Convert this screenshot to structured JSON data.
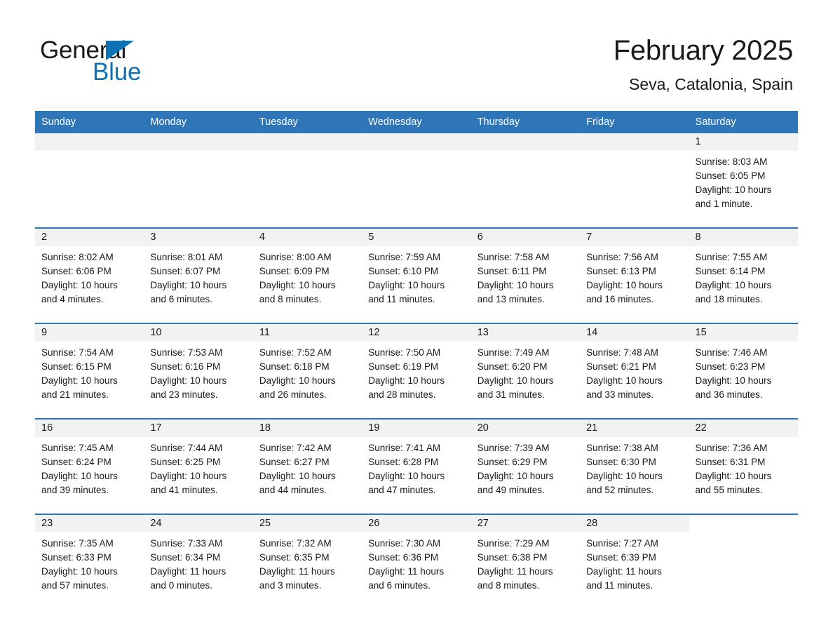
{
  "logo": {
    "word1": "General",
    "word2": "Blue",
    "triangle_color": "#0e72b5"
  },
  "header": {
    "month_title": "February 2025",
    "location": "Seva, Catalonia, Spain",
    "accent_color": "#2f76b8"
  },
  "calendar": {
    "weekday_headers": [
      "Sunday",
      "Monday",
      "Tuesday",
      "Wednesday",
      "Thursday",
      "Friday",
      "Saturday"
    ],
    "weeks": [
      [
        {
          "day": "",
          "blank": true
        },
        {
          "day": "",
          "blank": true
        },
        {
          "day": "",
          "blank": true
        },
        {
          "day": "",
          "blank": true
        },
        {
          "day": "",
          "blank": true
        },
        {
          "day": "",
          "blank": true
        },
        {
          "day": "1",
          "sunrise": "Sunrise: 8:03 AM",
          "sunset": "Sunset: 6:05 PM",
          "daylight1": "Daylight: 10 hours",
          "daylight2": "and 1 minute."
        }
      ],
      [
        {
          "day": "2",
          "sunrise": "Sunrise: 8:02 AM",
          "sunset": "Sunset: 6:06 PM",
          "daylight1": "Daylight: 10 hours",
          "daylight2": "and 4 minutes."
        },
        {
          "day": "3",
          "sunrise": "Sunrise: 8:01 AM",
          "sunset": "Sunset: 6:07 PM",
          "daylight1": "Daylight: 10 hours",
          "daylight2": "and 6 minutes."
        },
        {
          "day": "4",
          "sunrise": "Sunrise: 8:00 AM",
          "sunset": "Sunset: 6:09 PM",
          "daylight1": "Daylight: 10 hours",
          "daylight2": "and 8 minutes."
        },
        {
          "day": "5",
          "sunrise": "Sunrise: 7:59 AM",
          "sunset": "Sunset: 6:10 PM",
          "daylight1": "Daylight: 10 hours",
          "daylight2": "and 11 minutes."
        },
        {
          "day": "6",
          "sunrise": "Sunrise: 7:58 AM",
          "sunset": "Sunset: 6:11 PM",
          "daylight1": "Daylight: 10 hours",
          "daylight2": "and 13 minutes."
        },
        {
          "day": "7",
          "sunrise": "Sunrise: 7:56 AM",
          "sunset": "Sunset: 6:13 PM",
          "daylight1": "Daylight: 10 hours",
          "daylight2": "and 16 minutes."
        },
        {
          "day": "8",
          "sunrise": "Sunrise: 7:55 AM",
          "sunset": "Sunset: 6:14 PM",
          "daylight1": "Daylight: 10 hours",
          "daylight2": "and 18 minutes."
        }
      ],
      [
        {
          "day": "9",
          "sunrise": "Sunrise: 7:54 AM",
          "sunset": "Sunset: 6:15 PM",
          "daylight1": "Daylight: 10 hours",
          "daylight2": "and 21 minutes."
        },
        {
          "day": "10",
          "sunrise": "Sunrise: 7:53 AM",
          "sunset": "Sunset: 6:16 PM",
          "daylight1": "Daylight: 10 hours",
          "daylight2": "and 23 minutes."
        },
        {
          "day": "11",
          "sunrise": "Sunrise: 7:52 AM",
          "sunset": "Sunset: 6:18 PM",
          "daylight1": "Daylight: 10 hours",
          "daylight2": "and 26 minutes."
        },
        {
          "day": "12",
          "sunrise": "Sunrise: 7:50 AM",
          "sunset": "Sunset: 6:19 PM",
          "daylight1": "Daylight: 10 hours",
          "daylight2": "and 28 minutes."
        },
        {
          "day": "13",
          "sunrise": "Sunrise: 7:49 AM",
          "sunset": "Sunset: 6:20 PM",
          "daylight1": "Daylight: 10 hours",
          "daylight2": "and 31 minutes."
        },
        {
          "day": "14",
          "sunrise": "Sunrise: 7:48 AM",
          "sunset": "Sunset: 6:21 PM",
          "daylight1": "Daylight: 10 hours",
          "daylight2": "and 33 minutes."
        },
        {
          "day": "15",
          "sunrise": "Sunrise: 7:46 AM",
          "sunset": "Sunset: 6:23 PM",
          "daylight1": "Daylight: 10 hours",
          "daylight2": "and 36 minutes."
        }
      ],
      [
        {
          "day": "16",
          "sunrise": "Sunrise: 7:45 AM",
          "sunset": "Sunset: 6:24 PM",
          "daylight1": "Daylight: 10 hours",
          "daylight2": "and 39 minutes."
        },
        {
          "day": "17",
          "sunrise": "Sunrise: 7:44 AM",
          "sunset": "Sunset: 6:25 PM",
          "daylight1": "Daylight: 10 hours",
          "daylight2": "and 41 minutes."
        },
        {
          "day": "18",
          "sunrise": "Sunrise: 7:42 AM",
          "sunset": "Sunset: 6:27 PM",
          "daylight1": "Daylight: 10 hours",
          "daylight2": "and 44 minutes."
        },
        {
          "day": "19",
          "sunrise": "Sunrise: 7:41 AM",
          "sunset": "Sunset: 6:28 PM",
          "daylight1": "Daylight: 10 hours",
          "daylight2": "and 47 minutes."
        },
        {
          "day": "20",
          "sunrise": "Sunrise: 7:39 AM",
          "sunset": "Sunset: 6:29 PM",
          "daylight1": "Daylight: 10 hours",
          "daylight2": "and 49 minutes."
        },
        {
          "day": "21",
          "sunrise": "Sunrise: 7:38 AM",
          "sunset": "Sunset: 6:30 PM",
          "daylight1": "Daylight: 10 hours",
          "daylight2": "and 52 minutes."
        },
        {
          "day": "22",
          "sunrise": "Sunrise: 7:36 AM",
          "sunset": "Sunset: 6:31 PM",
          "daylight1": "Daylight: 10 hours",
          "daylight2": "and 55 minutes."
        }
      ],
      [
        {
          "day": "23",
          "sunrise": "Sunrise: 7:35 AM",
          "sunset": "Sunset: 6:33 PM",
          "daylight1": "Daylight: 10 hours",
          "daylight2": "and 57 minutes."
        },
        {
          "day": "24",
          "sunrise": "Sunrise: 7:33 AM",
          "sunset": "Sunset: 6:34 PM",
          "daylight1": "Daylight: 11 hours",
          "daylight2": "and 0 minutes."
        },
        {
          "day": "25",
          "sunrise": "Sunrise: 7:32 AM",
          "sunset": "Sunset: 6:35 PM",
          "daylight1": "Daylight: 11 hours",
          "daylight2": "and 3 minutes."
        },
        {
          "day": "26",
          "sunrise": "Sunrise: 7:30 AM",
          "sunset": "Sunset: 6:36 PM",
          "daylight1": "Daylight: 11 hours",
          "daylight2": "and 6 minutes."
        },
        {
          "day": "27",
          "sunrise": "Sunrise: 7:29 AM",
          "sunset": "Sunset: 6:38 PM",
          "daylight1": "Daylight: 11 hours",
          "daylight2": "and 8 minutes."
        },
        {
          "day": "28",
          "sunrise": "Sunrise: 7:27 AM",
          "sunset": "Sunset: 6:39 PM",
          "daylight1": "Daylight: 11 hours",
          "daylight2": "and 11 minutes."
        },
        {
          "day": "",
          "blank": true
        }
      ]
    ]
  }
}
